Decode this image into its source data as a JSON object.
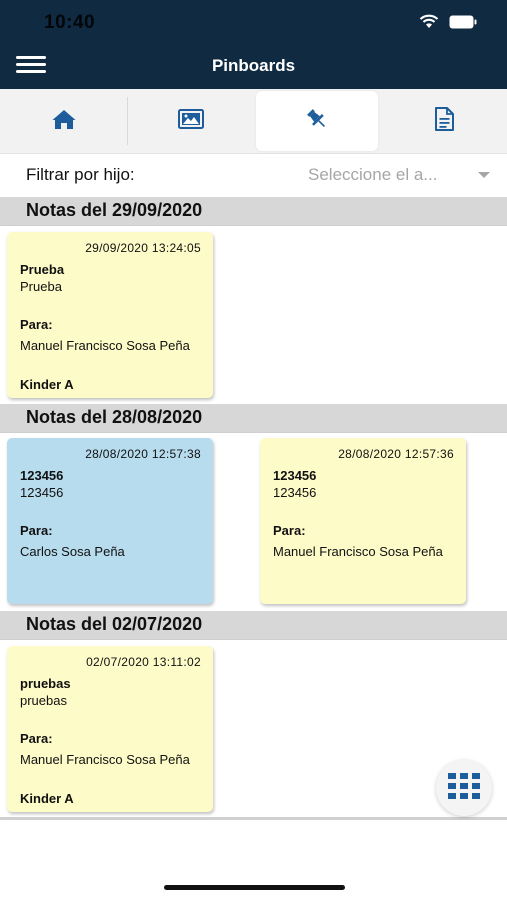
{
  "status": {
    "time": "10:40"
  },
  "header": {
    "title": "Pinboards"
  },
  "tabs": [
    {
      "id": "home",
      "icon": "home-icon"
    },
    {
      "id": "gallery",
      "icon": "image-icon"
    },
    {
      "id": "pinboards",
      "icon": "pin-icon",
      "selected": true
    },
    {
      "id": "documents",
      "icon": "document-icon"
    }
  ],
  "filter": {
    "label": "Filtrar por hijo:",
    "placeholder": "Seleccione el a..."
  },
  "sections": [
    {
      "heading": "Notas del 29/09/2020",
      "notes": [
        {
          "date": "29/09/2020 13:24:05",
          "title": "Prueba",
          "body": "Prueba",
          "para_label": "Para:",
          "to": "Manuel Francisco Sosa Peña",
          "group": "Kinder A",
          "color": "yellow"
        }
      ]
    },
    {
      "heading": "Notas del 28/08/2020",
      "notes": [
        {
          "date": "28/08/2020 12:57:38",
          "title": "123456",
          "body": "123456",
          "para_label": "Para:",
          "to": "Carlos Sosa Peña",
          "group": "",
          "color": "blue"
        },
        {
          "date": "28/08/2020 12:57:36",
          "title": "123456",
          "body": "123456",
          "para_label": "Para:",
          "to": "Manuel Francisco Sosa Peña",
          "group": "",
          "color": "yellow"
        }
      ]
    },
    {
      "heading": "Notas del 02/07/2020",
      "notes": [
        {
          "date": "02/07/2020 13:11:02",
          "title": "pruebas",
          "body": "pruebas",
          "para_label": "Para:",
          "to": "Manuel Francisco Sosa Peña",
          "group": "Kinder A",
          "color": "yellow"
        }
      ]
    }
  ],
  "colors": {
    "header_bg": "#0f2a41",
    "note_yellow": "#fdfbc8",
    "note_blue": "#b7dcee",
    "icon_blue": "#1d5d9b"
  }
}
